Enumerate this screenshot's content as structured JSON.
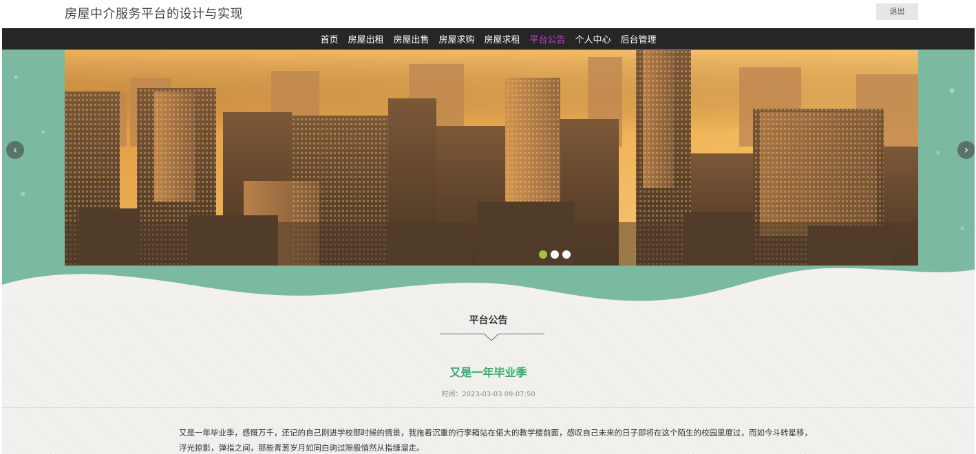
{
  "header": {
    "site_title": "房屋中介服务平台的设计与实现",
    "logout_label": "退出"
  },
  "nav": {
    "items": [
      {
        "label": "首页"
      },
      {
        "label": "房屋出租"
      },
      {
        "label": "房屋出售"
      },
      {
        "label": "房屋求购"
      },
      {
        "label": "房屋求租"
      },
      {
        "label": "平台公告"
      },
      {
        "label": "个人中心"
      },
      {
        "label": "后台管理"
      }
    ],
    "active_index": 5,
    "active_color": "#c53bd6"
  },
  "carousel": {
    "prev_icon": "chevron-left-icon",
    "next_icon": "chevron-right-icon",
    "prev_glyph": "‹",
    "next_glyph": "›",
    "slide_count": 3,
    "active_slide": 0,
    "accent_color": "#7bb9a1"
  },
  "notice": {
    "section_title": "平台公告",
    "article_title": "又是一年毕业季",
    "time_text": "时间：2023-03-03 09:07:50",
    "body": "又是一年毕业季，感慨万千，还记的自己刚进学校那时候的情景，我拖着沉重的行李箱站在偌大的教学楼前面，感叹自己未来的日子即将在这个陌生的校园里度过，而如今斗转星移，浮光掠影，弹指之间，那些青葱岁月如同白驹过隙般悄然从指缝溜走。",
    "title_color": "#3aa86f"
  }
}
